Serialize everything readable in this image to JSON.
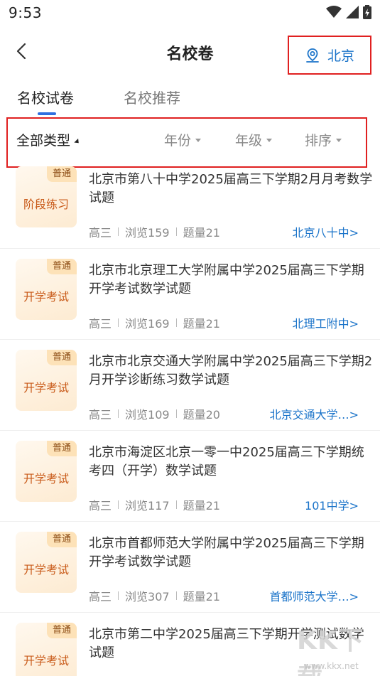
{
  "status": {
    "time": "9:53"
  },
  "header": {
    "title": "名校卷",
    "city": "北京"
  },
  "tabs": [
    {
      "label": "名校试卷",
      "active": true
    },
    {
      "label": "名校推荐",
      "active": false
    }
  ],
  "filters": {
    "type": "全部类型",
    "year": "年份",
    "grade": "年级",
    "sort": "排序"
  },
  "papers": [
    {
      "badge": "普通",
      "category": "阶段练习",
      "title": "北京市第八十中学2025届高三下学期2月月考数学试题",
      "grade": "高三",
      "views": "浏览159",
      "count": "题量21",
      "school": "北京八十中>"
    },
    {
      "badge": "普通",
      "category": "开学考试",
      "title": "北京市北京理工大学附属中学2025届高三下学期开学考试数学试题",
      "grade": "高三",
      "views": "浏览169",
      "count": "题量21",
      "school": "北理工附中>"
    },
    {
      "badge": "普通",
      "category": "开学考试",
      "title": "北京市北京交通大学附属中学2025届高三下学期2月开学诊断练习数学试题",
      "grade": "高三",
      "views": "浏览109",
      "count": "题量20",
      "school": "北京交通大学…>"
    },
    {
      "badge": "普通",
      "category": "开学考试",
      "title": "北京市海淀区北京一零一中2025届高三下学期统考四（开学）数学试题",
      "grade": "高三",
      "views": "浏览117",
      "count": "题量21",
      "school": "101中学>"
    },
    {
      "badge": "普通",
      "category": "开学考试",
      "title": "北京市首都师范大学附属中学2025届高三下学期开学考试数学试题",
      "grade": "高三",
      "views": "浏览307",
      "count": "题量21",
      "school": "首都师范大学…>"
    },
    {
      "badge": "普通",
      "category": "开学考试",
      "title": "北京市第二中学2025届高三下学期开学测试数学试题"
    }
  ],
  "watermark": {
    "text": "KK下载",
    "url": "www.kkx.net"
  },
  "colors": {
    "accent": "#1a73c9",
    "tab_underline": "#2f6fe0",
    "highlight_box": "#e02020",
    "category_text": "#c95b1a"
  }
}
